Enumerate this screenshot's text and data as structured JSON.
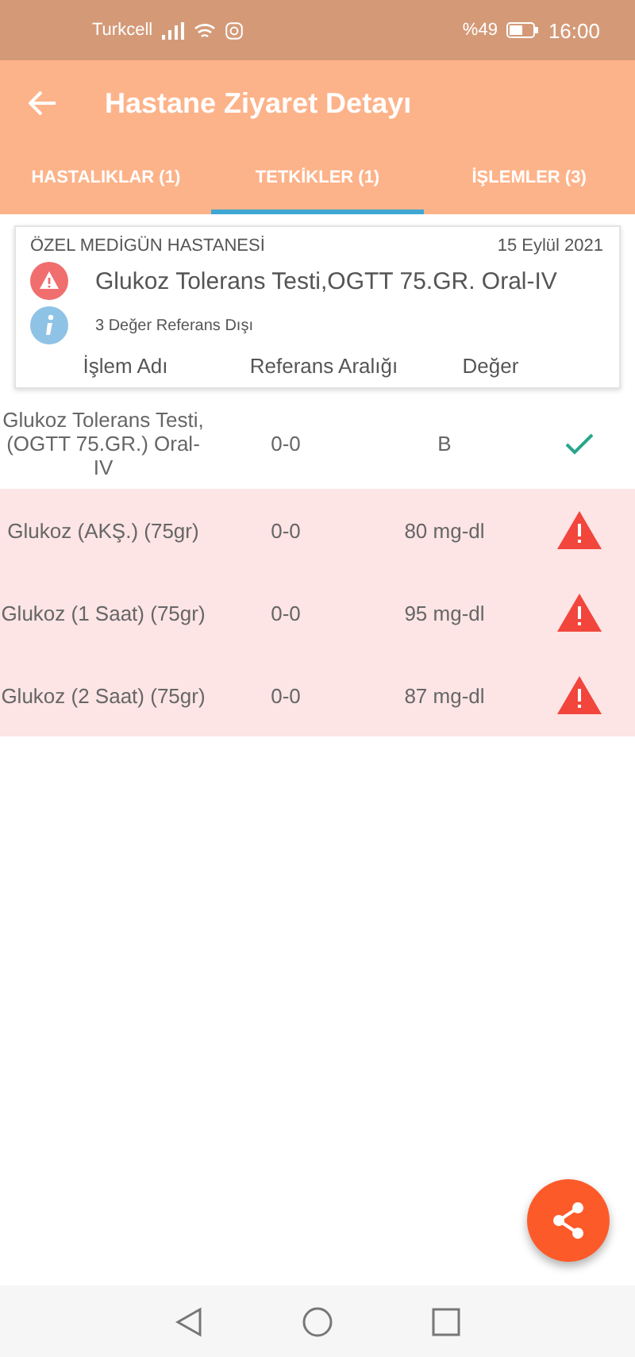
{
  "status_bar": {
    "carrier": "Turkcell",
    "battery": "%49",
    "time": "16:00"
  },
  "header": {
    "title": "Hastane Ziyaret Detayı"
  },
  "tabs": [
    {
      "label": "HASTALIKLAR (1)",
      "selected": false
    },
    {
      "label": "TETKİKLER (1)",
      "selected": true
    },
    {
      "label": "İŞLEMLER (3)",
      "selected": false
    }
  ],
  "card": {
    "hospital": "ÖZEL MEDİGÜN HASTANESİ",
    "date": "15 Eylül 2021",
    "test_name": "Glukoz Tolerans Testi,OGTT 75.GR. Oral-IV",
    "note": "3 Değer Referans Dışı",
    "columns": [
      "İşlem Adı",
      "Referans Aralığı",
      "Değer"
    ]
  },
  "rows": [
    {
      "name": "Glukoz Tolerans Testi,(OGTT 75.GR.) Oral-IV",
      "range": "0-0",
      "value": "B",
      "out_of_range": false
    },
    {
      "name": "Glukoz (AKŞ.) (75gr)",
      "range": "0-0",
      "value": "80 mg-dl",
      "out_of_range": true
    },
    {
      "name": "Glukoz (1 Saat) (75gr)",
      "range": "0-0",
      "value": "95 mg-dl",
      "out_of_range": true
    },
    {
      "name": "Glukoz (2 Saat) (75gr)",
      "range": "0-0",
      "value": "87 mg-dl",
      "out_of_range": true
    }
  ]
}
